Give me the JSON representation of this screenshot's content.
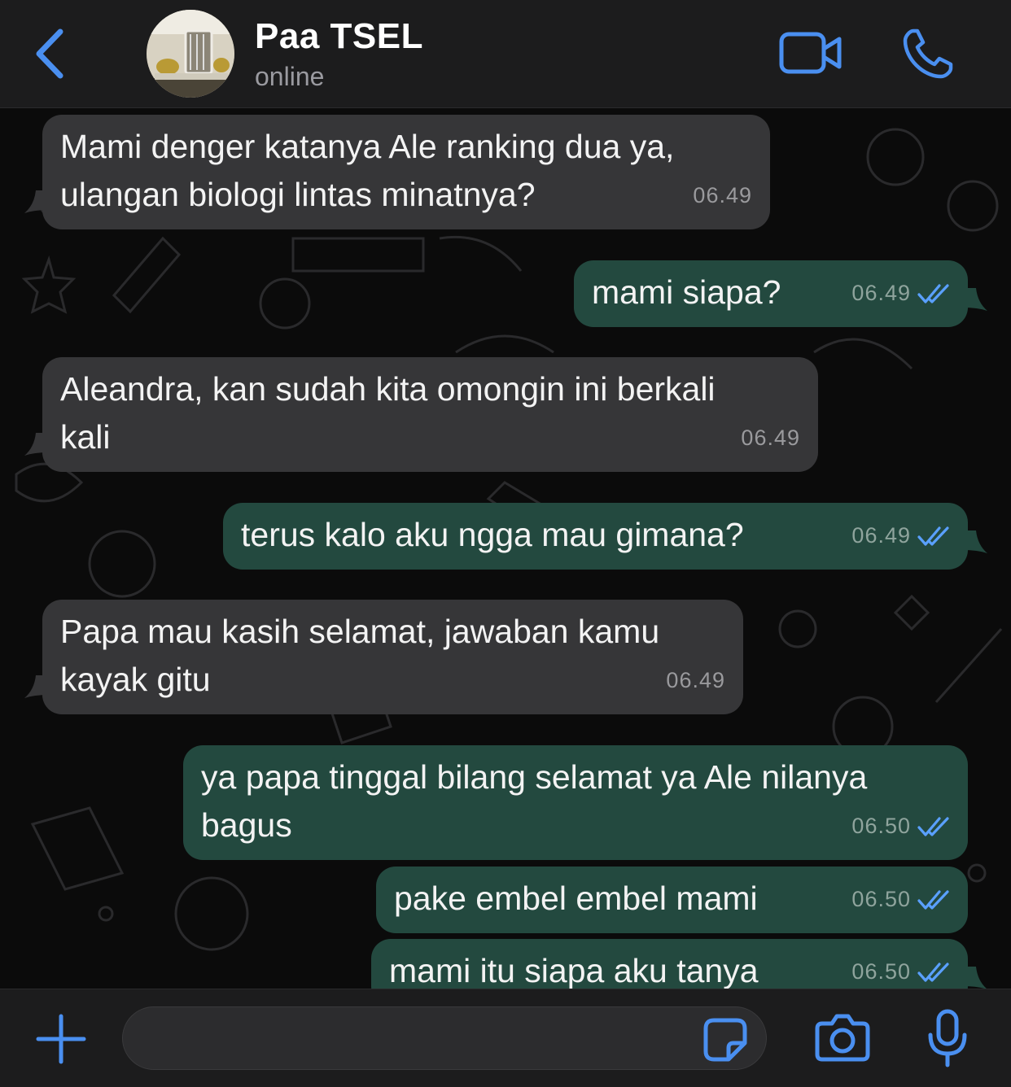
{
  "header": {
    "contact_name": "Paa TSEL",
    "status": "online"
  },
  "icons": {
    "back": "chevron-left-icon",
    "video": "video-camera-icon",
    "call": "phone-icon",
    "add": "plus-icon",
    "sticker": "sticker-icon",
    "camera": "camera-icon",
    "mic": "microphone-icon",
    "read": "double-check-icon"
  },
  "colors": {
    "accent": "#4a8ff0",
    "incoming_bubble": "#363638",
    "outgoing_bubble": "#23493f",
    "header_bg": "#1c1c1d"
  },
  "messages": [
    {
      "direction": "in",
      "lines": [
        "Mami denger katanya Ale ranking dua ya,",
        "ulangan biologi lintas minatnya?"
      ],
      "time": "06.49"
    },
    {
      "direction": "out",
      "lines": [
        "mami siapa?"
      ],
      "time": "06.49",
      "read": true
    },
    {
      "direction": "in",
      "lines": [
        "Aleandra, kan sudah kita omongin ini berkali",
        "kali"
      ],
      "time": "06.49"
    },
    {
      "direction": "out",
      "lines": [
        "terus kalo aku ngga mau gimana?"
      ],
      "time": "06.49",
      "read": true
    },
    {
      "direction": "in",
      "lines": [
        "Papa mau kasih selamat, jawaban kamu",
        "kayak gitu"
      ],
      "time": "06.49"
    },
    {
      "direction": "out",
      "lines": [
        "ya papa tinggal bilang selamat ya Ale nilanya",
        "bagus"
      ],
      "time": "06.50",
      "read": true
    },
    {
      "direction": "out",
      "lines": [
        "pake embel embel mami"
      ],
      "time": "06.50",
      "read": true
    },
    {
      "direction": "out",
      "lines": [
        "mami itu siapa aku tanya"
      ],
      "time": "06.50",
      "read": true
    }
  ],
  "composer": {
    "value": ""
  }
}
